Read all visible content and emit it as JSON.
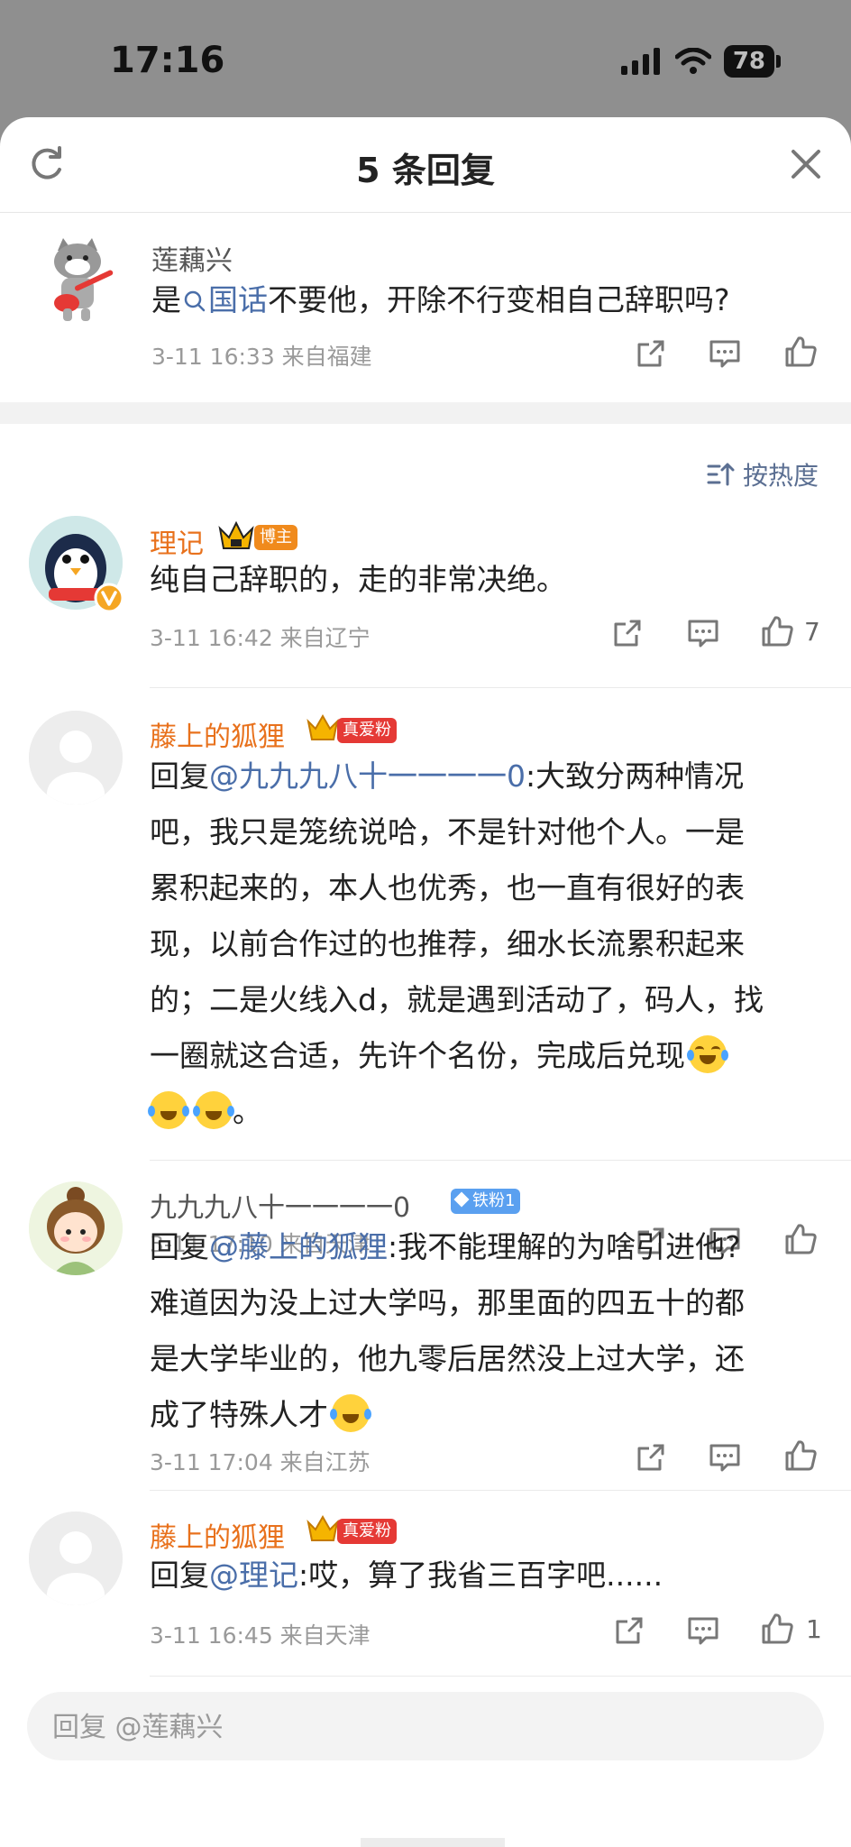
{
  "status": {
    "time": "17:16",
    "battery": "78"
  },
  "header": {
    "title": "5 条回复"
  },
  "root": {
    "username": "莲藕兴",
    "text_pre": "是",
    "topic": "国话",
    "text_post": "不要他，开除不行变相自己辞职吗?",
    "meta": "3-11 16:33 来自福建"
  },
  "sort": {
    "label": "按热度"
  },
  "replies": [
    {
      "username": "理记",
      "badge": "博主",
      "lines": [
        "纯自己辞职的，走的非常决绝。"
      ],
      "meta": "3-11 16:42 来自辽宁",
      "likes": "7"
    },
    {
      "username": "藤上的狐狸",
      "badge": "真爱粉",
      "reply_prefix": "回复",
      "mention": "@九九九八十一一一一0",
      "lines": [
        ":大致分两种情况",
        "吧，我只是笼统说哈，不是针对他个人。一是",
        "累积起来的，本人也优秀，也一直有很好的表",
        "现，以前合作过的也推荐，细水长流累积起来",
        "的；二是火线入d，就是遇到活动了，码人，找",
        "一圈就这合适，先许个名份，完成后兑现",
        "。"
      ],
      "meta": "3-11 17:10 来自天津",
      "likes": ""
    },
    {
      "username": "九九九八十一一一一0",
      "badge": "铁粉1",
      "reply_prefix": "回复",
      "mention": "@藤上的狐狸",
      "lines": [
        ":我不能理解的为啥引进他?",
        "难道因为没上过大学吗，那里面的四五十的都",
        "是大学毕业的，他九零后居然没上过大学，还",
        "成了特殊人才"
      ],
      "meta": "3-11 17:04 来自江苏",
      "likes": ""
    },
    {
      "username": "藤上的狐狸",
      "badge": "真爱粉",
      "reply_prefix": "回复",
      "mention": "@理记",
      "lines": [
        ":哎，算了我省三百字吧......"
      ],
      "meta": "3-11 16:45 来自天津",
      "likes": "1"
    }
  ],
  "input": {
    "placeholder": "回复 @莲藕兴"
  },
  "colors": {
    "orange_name": "#e8711c",
    "mention": "#4a6ea9",
    "meta": "#9a9a9a"
  }
}
